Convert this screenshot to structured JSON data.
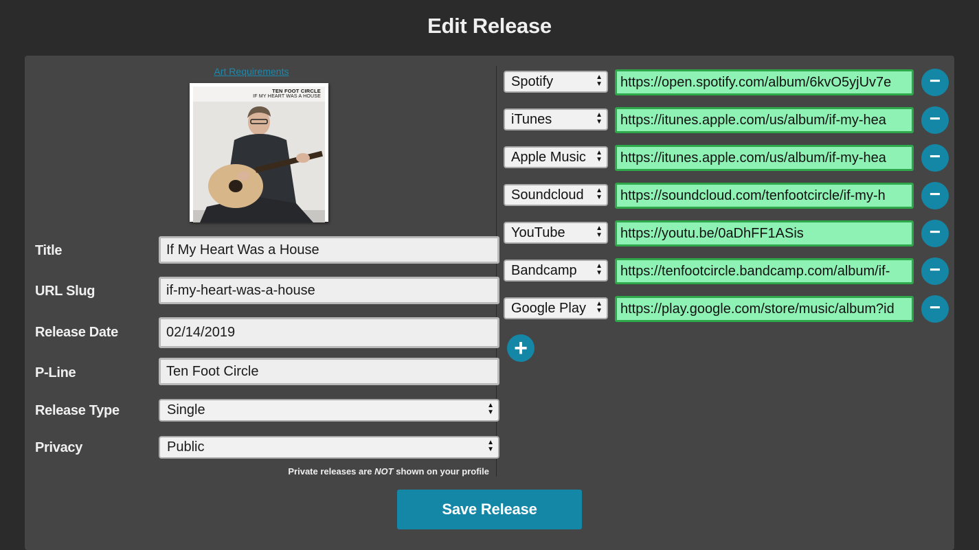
{
  "page": {
    "title": "Edit Release"
  },
  "art": {
    "requirements_link": "Art Requirements",
    "cover_artist": "TEN FOOT CIRCLE",
    "cover_title": "IF MY HEART WAS A HOUSE"
  },
  "form": {
    "title_label": "Title",
    "title_value": "If My Heart Was a House",
    "slug_label": "URL Slug",
    "slug_value": "if-my-heart-was-a-house",
    "date_label": "Release Date",
    "date_value": "02/14/2019",
    "pline_label": "P-Line",
    "pline_value": "Ten Foot Circle",
    "type_label": "Release Type",
    "type_value": "Single",
    "privacy_label": "Privacy",
    "privacy_value": "Public",
    "privacy_note_prefix": "Private releases are ",
    "privacy_note_emph": "NOT",
    "privacy_note_suffix": " shown on your profile"
  },
  "links": [
    {
      "service": "Spotify",
      "url": "https://open.spotify.com/album/6kvO5yjUv7e"
    },
    {
      "service": "iTunes",
      "url": "https://itunes.apple.com/us/album/if-my-hea"
    },
    {
      "service": "Apple Music",
      "url": "https://itunes.apple.com/us/album/if-my-hea"
    },
    {
      "service": "Soundcloud",
      "url": "https://soundcloud.com/tenfootcircle/if-my-h"
    },
    {
      "service": "YouTube",
      "url": "https://youtu.be/0aDhFF1ASis"
    },
    {
      "service": "Bandcamp",
      "url": "https://tenfootcircle.bandcamp.com/album/if-"
    },
    {
      "service": "Google Play",
      "url": "https://play.google.com/store/music/album?id"
    }
  ],
  "buttons": {
    "remove_label": "−",
    "add_label": "+",
    "save_label": "Save Release"
  },
  "colors": {
    "accent": "#1587a6",
    "valid_field": "#8ef2b4",
    "valid_border": "#2ea84a",
    "panel": "#454545",
    "background": "#2b2b2b"
  }
}
